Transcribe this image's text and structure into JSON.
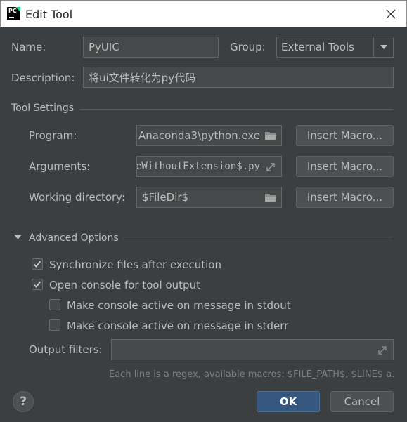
{
  "window": {
    "title": "Edit Tool",
    "app_icon_text": "PC"
  },
  "form": {
    "name_label": "Name:",
    "name_value": "PyUIC",
    "group_label": "Group:",
    "group_value": "External Tools",
    "description_label": "Description:",
    "description_value": "将ui文件转化为py代码"
  },
  "tool_settings": {
    "section_title": "Tool Settings",
    "program_label": "Program:",
    "program_value": "Anaconda3\\python.exe",
    "arguments_label": "Arguments:",
    "arguments_value": "eWithoutExtension$.py",
    "working_dir_label": "Working directory:",
    "working_dir_value": "$FileDir$",
    "insert_macro_label": "Insert Macro..."
  },
  "advanced": {
    "section_title": "Advanced Options",
    "sync_files": {
      "label": "Synchronize files after execution",
      "checked": true
    },
    "open_console": {
      "label": "Open console for tool output",
      "checked": true
    },
    "console_stdout": {
      "label": "Make console active on message in stdout",
      "checked": false
    },
    "console_stderr": {
      "label": "Make console active on message in stderr",
      "checked": false
    },
    "output_filters_label": "Output filters:",
    "output_filters_value": "",
    "hint": "Each line is a regex, available macros: $FILE_PATH$, $LINE$ a."
  },
  "footer": {
    "help_label": "?",
    "ok_label": "OK",
    "cancel_label": "Cancel"
  },
  "colors": {
    "background": "#3c3f41",
    "field": "#45494a",
    "primary": "#365880",
    "text": "#bbbbbb"
  }
}
